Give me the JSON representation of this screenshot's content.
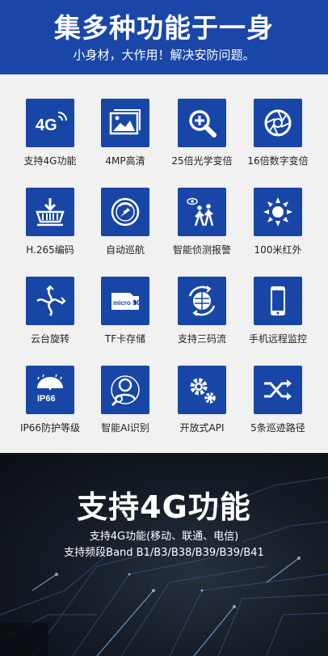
{
  "header": {
    "title": "集多种功能于一身",
    "subtitle": "小身材，大作用！解决安防问题。"
  },
  "features": [
    {
      "label": "支持4G功能",
      "icon": "4g-signal-icon"
    },
    {
      "label": "4MP高清",
      "icon": "picture-frame-icon"
    },
    {
      "label": "25倍光学变倍",
      "icon": "zoom-plus-icon"
    },
    {
      "label": "16倍数字变倍",
      "icon": "aperture-icon"
    },
    {
      "label": "H.265编码",
      "icon": "download-tray-icon"
    },
    {
      "label": "自动巡航",
      "icon": "cruise-radar-icon"
    },
    {
      "label": "智能侦测报警",
      "icon": "people-detection-icon"
    },
    {
      "label": "100米红外",
      "icon": "infrared-sun-icon"
    },
    {
      "label": "云台旋转",
      "icon": "ptz-rotation-icon"
    },
    {
      "label": "TF卡存储",
      "icon": "microsd-card-icon"
    },
    {
      "label": "支持三码流",
      "icon": "globe-stream-icon"
    },
    {
      "label": "手机远程监控",
      "icon": "smartphone-icon"
    },
    {
      "label": "IP66防护等级",
      "icon": "umbrella-ip66-icon"
    },
    {
      "label": "智能AI识别",
      "icon": "face-scan-icon"
    },
    {
      "label": "开放式API",
      "icon": "gears-icon"
    },
    {
      "label": "5条巡迹路径",
      "icon": "shuffle-icon"
    }
  ],
  "icon_text": {
    "fourg": "4G",
    "microsd": "micro SD",
    "ip66": "IP66"
  },
  "bottom": {
    "title": "支持4G功能",
    "line1": "支持4G功能(移动、联通、电信)",
    "line2": "支持频段Band B1/B3/B38/B39/B39/B41"
  },
  "colors": {
    "header_blue": "#1a46a8",
    "icon_blue": "#1846a6",
    "grid_bg": "#f1f1f1"
  }
}
